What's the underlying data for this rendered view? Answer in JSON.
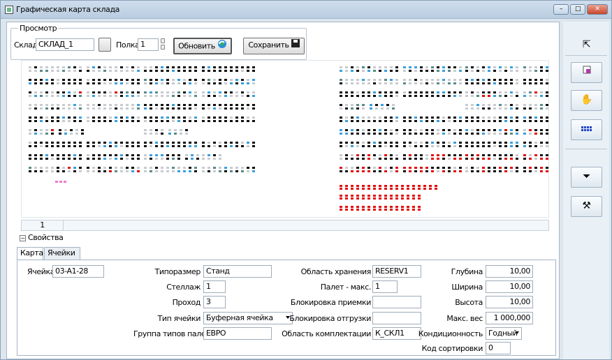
{
  "window": {
    "title": "Графическая карта склада",
    "btn_min": "–",
    "btn_max": "□",
    "btn_close": "✕"
  },
  "view": {
    "group_title": "Просмотр",
    "warehouse_label": "Склад",
    "warehouse_value": "СКЛАД_1",
    "shelf_label": "Полка",
    "shelf_value": "1",
    "refresh_label": "Обновить",
    "save_label": "Сохранить"
  },
  "status": {
    "page": "1"
  },
  "properties": {
    "header": "Свойства",
    "tabs": [
      "Карта",
      "Ячейки"
    ]
  },
  "form": {
    "cell_label": "Ячейка",
    "cell_value": "03-A1-28",
    "size_label": "Типоразмер",
    "size_value": "Станд",
    "rack_label": "Стеллаж",
    "rack_value": "1",
    "aisle_label": "Проход",
    "aisle_value": "3",
    "cell_type_label": "Тип ячейки",
    "cell_type_value": "Буферная ячейка",
    "pallet_group_label": "Группа типов палет",
    "pallet_group_value": "ЕВРО",
    "storage_area_label": "Область хранения",
    "storage_area_value": "RESERV1",
    "pallet_max_label": "Палет - макс.",
    "pallet_max_value": "1",
    "receipt_block_label": "Блокировка приемки",
    "receipt_block_value": "",
    "ship_block_label": "Блокировка отгрузки",
    "ship_block_value": "",
    "picking_area_label": "Область комплектации",
    "picking_area_value": "К_СКЛ1",
    "depth_label": "Глубина",
    "depth_value": "10,00",
    "width_label": "Ширина",
    "width_value": "10,00",
    "height_label": "Высота",
    "height_value": "10,00",
    "max_weight_label": "Макс. вес",
    "max_weight_value": "1 000,000",
    "condition_label": "Кондиционность",
    "condition_value": "Годный",
    "sort_code_label": "Код сортировки",
    "sort_code_value": "0"
  },
  "toolbar": {
    "pointer": "pointer-icon",
    "export": "export-icon",
    "hand": "hand-icon",
    "grid": "grid-icon",
    "filter": "filter-icon",
    "tools": "tools-icon"
  },
  "colors": {
    "free": "#c8ccd0",
    "occupied": "#111111",
    "reserved": "#3aa0e0",
    "teal": "#5b8a8a",
    "blocked": "#e01010",
    "special": "#f07ad0"
  }
}
